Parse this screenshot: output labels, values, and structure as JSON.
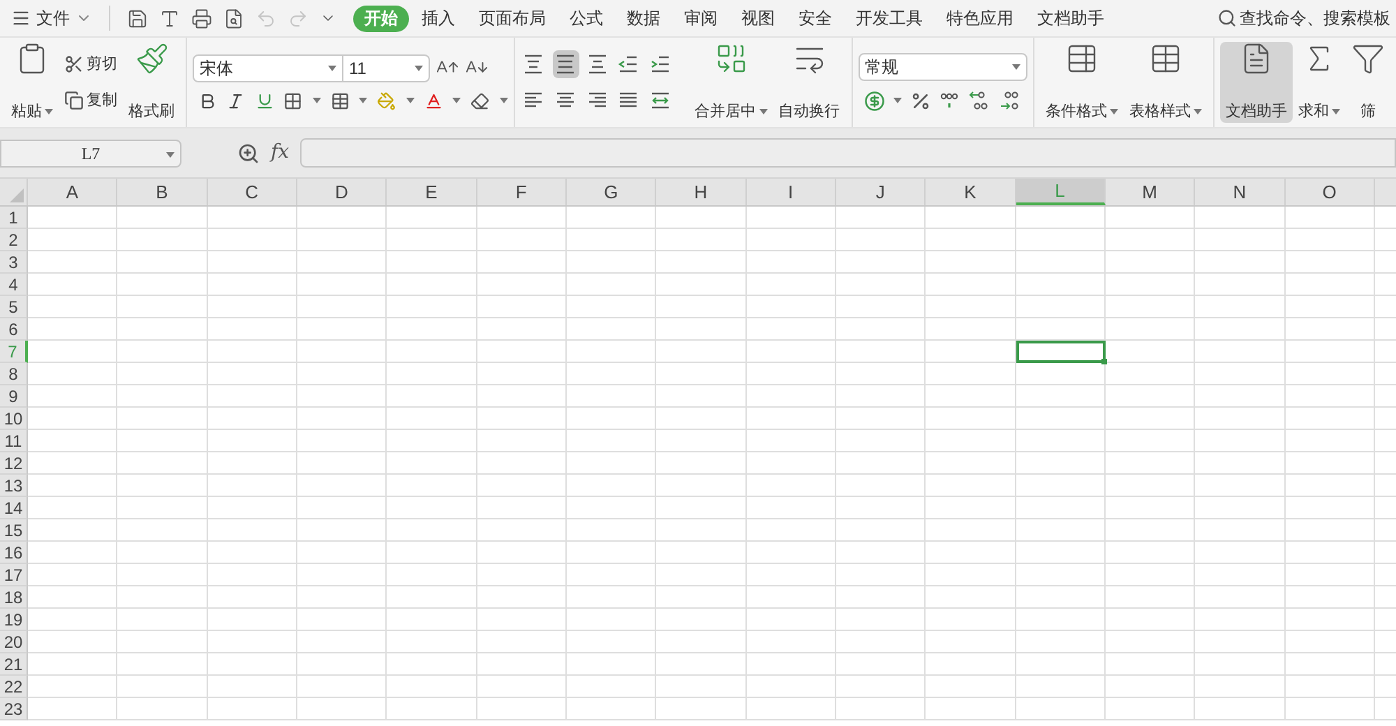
{
  "menu": {
    "label": "文件"
  },
  "quick_access": [
    {
      "kind": "save",
      "disabled": false
    },
    {
      "kind": "format",
      "disabled": false
    },
    {
      "kind": "print",
      "disabled": false
    },
    {
      "kind": "preview",
      "disabled": false
    },
    {
      "kind": "undo",
      "disabled": true
    },
    {
      "kind": "redo",
      "disabled": true
    },
    {
      "kind": "more",
      "disabled": false
    }
  ],
  "tabs": [
    {
      "label": "开始",
      "selected": true
    },
    {
      "label": "插入",
      "selected": false
    },
    {
      "label": "页面布局",
      "selected": false
    },
    {
      "label": "公式",
      "selected": false
    },
    {
      "label": "数据",
      "selected": false
    },
    {
      "label": "审阅",
      "selected": false
    },
    {
      "label": "视图",
      "selected": false
    },
    {
      "label": "安全",
      "selected": false
    },
    {
      "label": "开发工具",
      "selected": false
    },
    {
      "label": "特色应用",
      "selected": false
    },
    {
      "label": "文档助手",
      "selected": false
    }
  ],
  "search": {
    "placeholder": "查找命令、搜索模板"
  },
  "clipboard": {
    "paste": "粘贴",
    "cut": "剪切",
    "copy": "复制",
    "format_painter": "格式刷"
  },
  "font": {
    "name": "宋体",
    "size": "11"
  },
  "alignment": {
    "items": [
      {
        "kind": "top",
        "pressed": false
      },
      {
        "kind": "middle",
        "pressed": true
      },
      {
        "kind": "bottom",
        "pressed": false
      },
      {
        "kind": "outdent",
        "pressed": false
      },
      {
        "kind": "indent",
        "pressed": false
      },
      {
        "kind": "left",
        "pressed": false
      },
      {
        "kind": "center",
        "pressed": false
      },
      {
        "kind": "right",
        "pressed": false
      },
      {
        "kind": "justify",
        "pressed": false
      },
      {
        "kind": "distribute",
        "pressed": false
      }
    ],
    "merge": "合并居中",
    "wrap": "自动换行"
  },
  "number": {
    "format": "常规"
  },
  "styles": {
    "conditional": "条件格式",
    "table": "表格样式"
  },
  "tools": [
    {
      "kind": "assistant",
      "label": "文档助手",
      "selected": true,
      "caret": false
    },
    {
      "kind": "sum",
      "label": "求和",
      "selected": false,
      "caret": true
    },
    {
      "kind": "filter",
      "label": "筛",
      "selected": false,
      "caret": false
    }
  ],
  "formula_bar": {
    "name_box": "L7",
    "fx": "fx"
  },
  "sheet": {
    "columns": [
      {
        "label": "A",
        "selected": false
      },
      {
        "label": "B",
        "selected": false
      },
      {
        "label": "C",
        "selected": false
      },
      {
        "label": "D",
        "selected": false
      },
      {
        "label": "E",
        "selected": false
      },
      {
        "label": "F",
        "selected": false
      },
      {
        "label": "G",
        "selected": false
      },
      {
        "label": "H",
        "selected": false
      },
      {
        "label": "I",
        "selected": false
      },
      {
        "label": "J",
        "selected": false
      },
      {
        "label": "K",
        "selected": false
      },
      {
        "label": "L",
        "selected": true
      },
      {
        "label": "M",
        "selected": false
      },
      {
        "label": "N",
        "selected": false
      },
      {
        "label": "O",
        "selected": false
      }
    ],
    "rows": [
      {
        "label": "1",
        "selected": false
      },
      {
        "label": "2",
        "selected": false
      },
      {
        "label": "3",
        "selected": false
      },
      {
        "label": "4",
        "selected": false
      },
      {
        "label": "5",
        "selected": false
      },
      {
        "label": "6",
        "selected": false
      },
      {
        "label": "7",
        "selected": true
      },
      {
        "label": "8",
        "selected": false
      },
      {
        "label": "9",
        "selected": false
      },
      {
        "label": "10",
        "selected": false
      },
      {
        "label": "11",
        "selected": false
      },
      {
        "label": "12",
        "selected": false
      },
      {
        "label": "13",
        "selected": false
      },
      {
        "label": "14",
        "selected": false
      },
      {
        "label": "15",
        "selected": false
      },
      {
        "label": "16",
        "selected": false
      },
      {
        "label": "17",
        "selected": false
      },
      {
        "label": "18",
        "selected": false
      },
      {
        "label": "19",
        "selected": false
      },
      {
        "label": "20",
        "selected": false
      },
      {
        "label": "21",
        "selected": false
      },
      {
        "label": "22",
        "selected": false
      },
      {
        "label": "23",
        "selected": false
      }
    ]
  }
}
